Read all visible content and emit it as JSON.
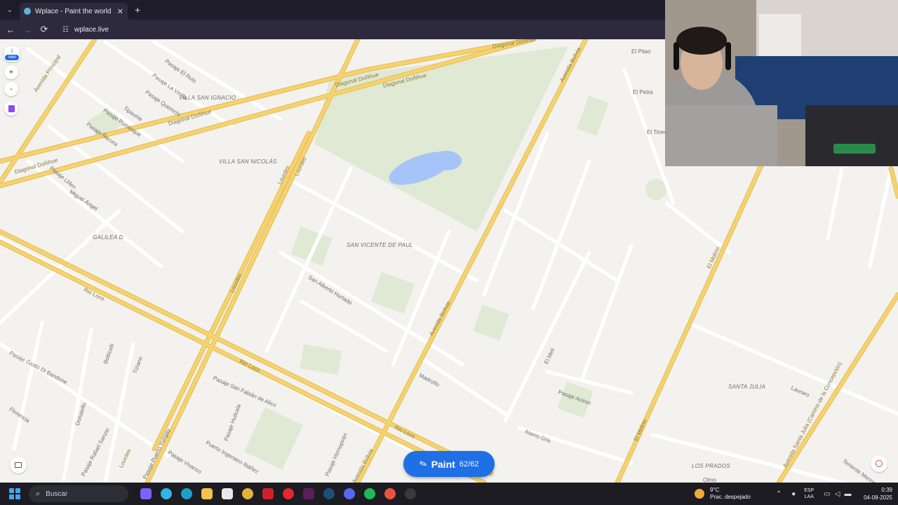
{
  "browser": {
    "tab_title": "Wplace - Paint the world",
    "close_symbol": "✕",
    "new_tab_symbol": "+",
    "tab_list_symbol": "⌄",
    "url": "wplace.live",
    "back_symbol": "←",
    "forward_symbol": "→",
    "reload_symbol": "⟳",
    "site_info_symbol": "☷"
  },
  "controls": {
    "info_symbol": "i",
    "new_badge": "new",
    "zoom_in_symbol": "+",
    "zoom_out_symbol": "-"
  },
  "paint": {
    "label": "Paint",
    "count": "62/62",
    "brush_symbol": "✎",
    "color": "#1f6fe5"
  },
  "map": {
    "labels": {
      "avenida_principal": "Avenida Principal",
      "pasaje_el_rulo": "Pasaje El Rulo",
      "pasaje_la_vinilla": "Pasaje La Vinilla",
      "pasaje_quemchi": "Pasaje Quemchi",
      "tipaume": "Tipaume",
      "pasaje_purranque": "Pasaje Purranque",
      "pasaje_nacura": "Pasaje Ñacura",
      "pasaje_llifen": "Pasaje Llifen",
      "villa_san_ignacio": "Villa San Ignacio",
      "villa_san_nicolas": "Villa San Nicolás",
      "diagonal_donihue_1": "Diagonal Doñihue",
      "diagonal_donihue_2": "Diagonal Doñihue",
      "diagonal_donihue_3": "Diagonal Doñihue",
      "diagonal_donihue_4": "Diagonal Doñihue",
      "diagonal_donihue_5": "Diagonal Doñihue",
      "miguel_angel": "Miguel Ángel",
      "galilea_d": "Galilea D",
      "lourdes_1": "Lourdes",
      "lourdes_2": "Lourdes",
      "lourdes_3": "Lourdes",
      "lourdes_4": "Lourdes",
      "san_vicente_de_paul": "San Vicente de Paul",
      "san_alberto_hurtado": "San Alberto Hurtado",
      "rio_loco_1": "Rio Loco",
      "rio_loco_2": "Rio Loco",
      "rio_loco_3": "Rio Loco",
      "avenida_bolivia_1": "Avenida Bolivia",
      "avenida_bolivia_2": "Avenida Bolivia",
      "avenida_bolivia_3": "Avenida Bolivia",
      "el_pitao": "El Pitao",
      "el_petra": "El Petra",
      "el_tineo": "El Tineo",
      "el_molino_1": "El Molino",
      "el_molino_2": "El Molino",
      "el_meli": "El Meli",
      "madrono": "Madroño",
      "pasaje_aciron": "Pasaje Aciron",
      "alamo_gris": "Alamo Gris",
      "santa_julia": "Santa Julia",
      "lauraro": "Lauraro",
      "avenida_santa_julia": "Avenida Santa Julia (Camino de la Concepción)",
      "los_prados": "Los Prados",
      "teniente_merino": "Teniente Merino",
      "olmo": "Olmo",
      "pasaje_giotto": "Pasaje Giotto Di Bandone",
      "botticelli": "Botticelli",
      "tiziano": "Tiziano",
      "florencia": "Florencia",
      "donatello": "Donatello",
      "pasaje_rafael_sanzio": "Pasaje Rafael Sanzio",
      "pasaje_san_fabian": "Pasaje San Fabián de Alico",
      "pasaje_huilcala": "Pasaje Huilcala",
      "pasaje_puerto_yungay": "Pasaje Puerto Yungay",
      "pasaje_vivanco": "Pasaje Vivanco",
      "puerto_ingeniero_ibanez": "Puerto Ingeniero Ibáñez",
      "pasaje_hornopiren": "Pasaje Hornopirén"
    }
  },
  "taskbar": {
    "search_text": "Buscar",
    "search_symbol": "⌕",
    "weather_temp": "9°C",
    "weather_desc": "Prac. despejado",
    "lang_top": "ESP",
    "lang_bottom": "LAA",
    "time": "0:39",
    "date": "04-08-2025",
    "tray_chevron": "⌃"
  },
  "colors": {
    "map_bg": "#f3f2ef",
    "park": "#dfe9d4",
    "road_major": "#f6d36f",
    "water": "#a6c4f8",
    "accent": "#1f6fe5"
  }
}
